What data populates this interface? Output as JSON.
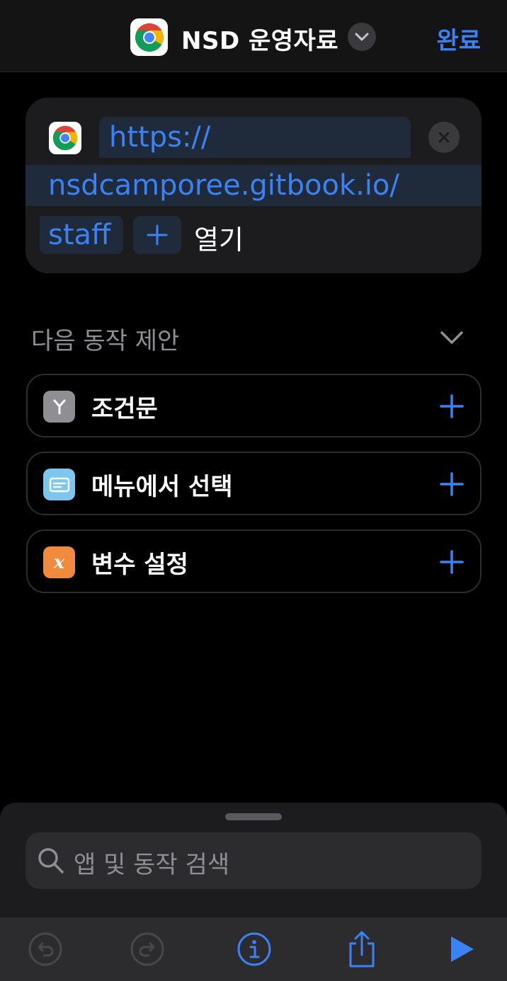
{
  "header": {
    "title": "NSD 운영자료",
    "done_label": "완료",
    "app_icon": "chrome-icon",
    "chevron_icon": "chevron-down-icon"
  },
  "action": {
    "url_parts": [
      "https://",
      "nsdcamporee.gitbook.io/",
      "staff"
    ],
    "verb": "열기",
    "app_icon": "chrome-icon",
    "clear_icon": "close-icon",
    "add_icon": "plus-icon"
  },
  "suggestions": {
    "title": "다음 동작 제안",
    "items": [
      {
        "label": "조건문",
        "icon": "branch-icon",
        "icon_bg": "#8e8e93"
      },
      {
        "label": "메뉴에서 선택",
        "icon": "menu-card-icon",
        "icon_bg": "#7cc6f0"
      },
      {
        "label": "변수 설정",
        "icon": "variable-x-icon",
        "icon_bg": "#f08a3c"
      }
    ]
  },
  "search": {
    "placeholder": "앱 및 동작 검색"
  },
  "toolbar": {
    "buttons": [
      "undo-icon",
      "redo-icon",
      "info-icon",
      "share-icon",
      "play-icon"
    ]
  },
  "colors": {
    "accent": "#3b82f6",
    "background": "#000000",
    "card": "#1c1c1e",
    "token_bg": "#1f2a3a",
    "muted": "#8e8e93"
  }
}
